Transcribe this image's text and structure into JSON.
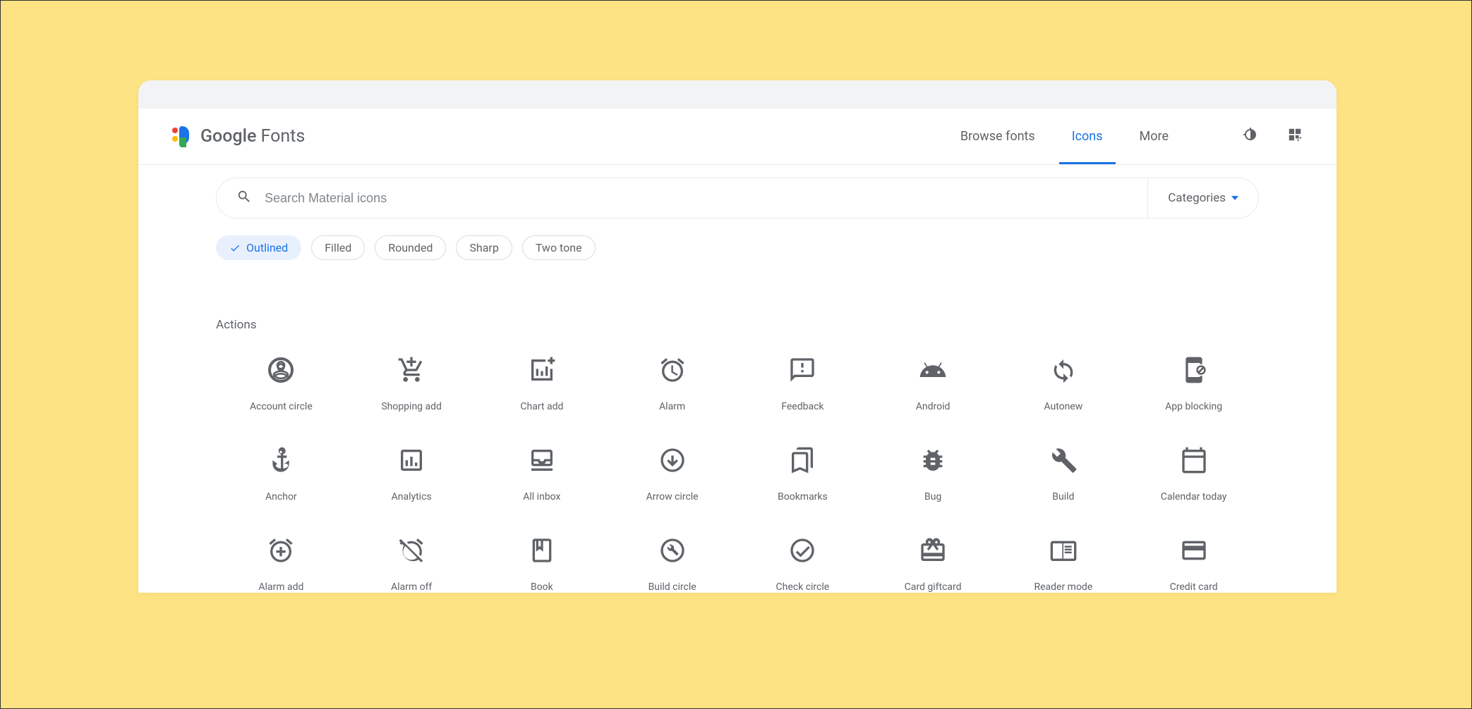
{
  "header": {
    "logo_text_a": "Google",
    "logo_text_b": " Fonts",
    "nav": {
      "browse": "Browse fonts",
      "icons": "Icons",
      "more": "More"
    }
  },
  "search": {
    "placeholder": "Search Material icons",
    "categories_label": "Categories"
  },
  "chips": {
    "outlined": "Outlined",
    "filled": "Filled",
    "rounded": "Rounded",
    "sharp": "Sharp",
    "twotone": "Two tone"
  },
  "section": {
    "title": "Actions"
  },
  "icons": {
    "r0c0": "Account circle",
    "r0c1": "Shopping add",
    "r0c2": "Chart add",
    "r0c3": "Alarm",
    "r0c4": "Feedback",
    "r0c5": "Android",
    "r0c6": "Autonew",
    "r0c7": "App blocking",
    "r1c0": "Anchor",
    "r1c1": "Analytics",
    "r1c2": "All inbox",
    "r1c3": "Arrow circle",
    "r1c4": "Bookmarks",
    "r1c5": "Bug",
    "r1c6": "Build",
    "r1c7": "Calendar today",
    "r2c0": "Alarm add",
    "r2c1": "Alarm off",
    "r2c2": "Book",
    "r2c3": "Build circle",
    "r2c4": "Check circle",
    "r2c5": "Card giftcard",
    "r2c6": "Reader mode",
    "r2c7": "Credit card"
  }
}
